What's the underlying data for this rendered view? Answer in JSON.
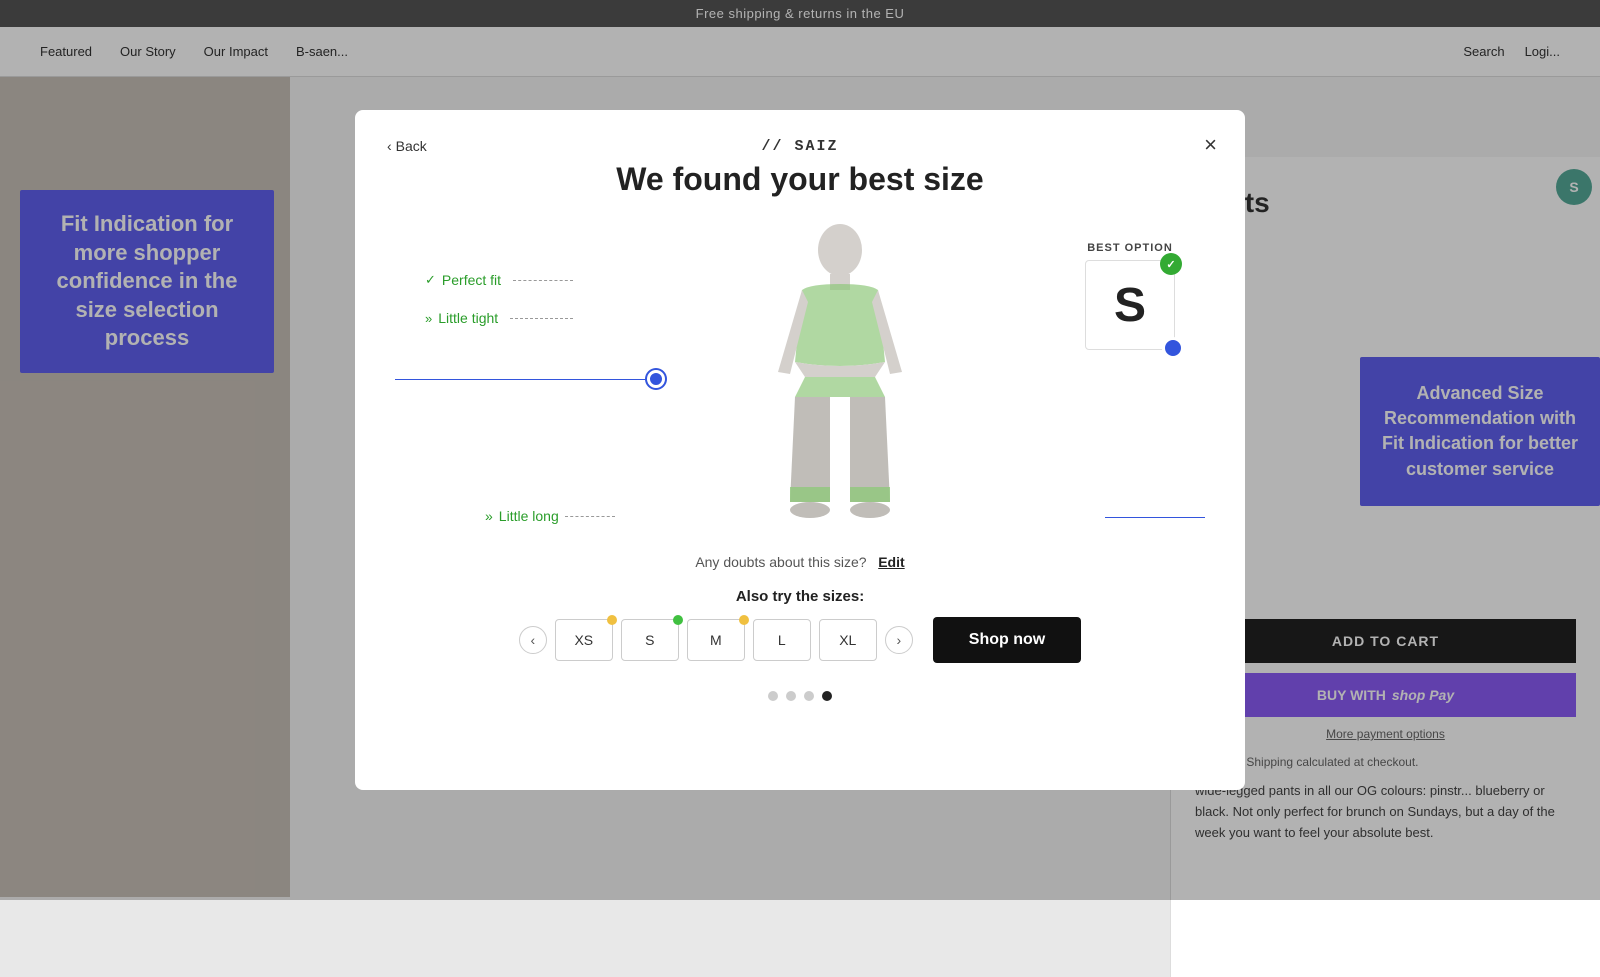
{
  "topbar": {
    "text": "Free shipping & returns in the EU"
  },
  "nav": {
    "left_items": [
      "Featured",
      "Our Story",
      "Our Impact",
      "B-saen..."
    ],
    "right_items": [
      "Search",
      "Logi..."
    ]
  },
  "background_right": {
    "title": "pants",
    "add_to_cart": "ADD TO CART",
    "buy_with": "BUY WITH",
    "more_payment": "More payment options",
    "shipping_text": "included. Shipping calculated at checkout.",
    "desc": "wide-legged pants in all our OG colours: pinstr... blueberry or black. Not only perfect for brunch on Sundays, but a day of the week you want to feel your absolute best."
  },
  "annotations": {
    "left": "Fit Indication for more shopper confidence in the size selection process",
    "right": "Advanced Size Recommendation with Fit Indication for better customer service"
  },
  "modal": {
    "logo": "// SAIZ",
    "back_label": "Back",
    "close_label": "×",
    "title": "We found your best size",
    "fit_items": [
      {
        "icon": "✓",
        "label": "Perfect fit",
        "type": "perfect"
      },
      {
        "icon": "»",
        "label": "Little tight",
        "type": "tight"
      }
    ],
    "fit_bottom": {
      "icon": "»",
      "label": "Little long",
      "type": "long"
    },
    "best_option_label": "BEST OPTION",
    "best_size": "S",
    "doubt_text": "Any doubts about this size?",
    "edit_label": "Edit",
    "also_try_label": "Also try the sizes:",
    "sizes": [
      {
        "label": "XS",
        "dot": "yellow"
      },
      {
        "label": "S",
        "dot": "green"
      },
      {
        "label": "M",
        "dot": "yellow"
      },
      {
        "label": "L",
        "dot": null
      },
      {
        "label": "XL",
        "dot": null
      }
    ],
    "shop_now_label": "Shop now",
    "pagination": [
      false,
      false,
      false,
      true
    ]
  }
}
